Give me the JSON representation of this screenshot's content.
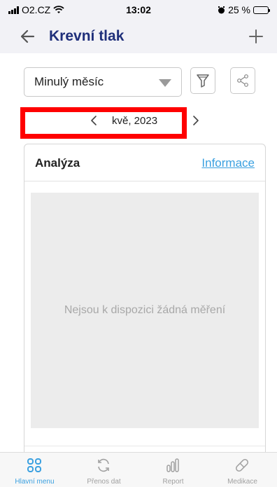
{
  "status_bar": {
    "carrier": "O2.CZ",
    "time": "13:02",
    "battery": "25 %",
    "icons": [
      "signal-icon",
      "wifi-icon",
      "alarm-icon",
      "battery-icon"
    ]
  },
  "nav": {
    "title": "Krevní tlak",
    "back_icon": "arrow-left-icon",
    "add_icon": "plus-icon"
  },
  "filter": {
    "period_value": "Minulý měsíc",
    "filter_icon": "funnel-icon",
    "share_icon": "share-icon"
  },
  "month_nav": {
    "label": "kvě, 2023",
    "highlight_color": "#ff0000"
  },
  "analysis": {
    "title": "Analýza",
    "info_link": "Informace",
    "empty_message": "Nejsou k dispozici žádná měření"
  },
  "tabs": [
    {
      "label": "Hlavní menu",
      "icon": "grid-icon",
      "active": true
    },
    {
      "label": "Přenos dat",
      "icon": "sync-icon",
      "active": false
    },
    {
      "label": "Report",
      "icon": "bar-chart-icon",
      "active": false
    },
    {
      "label": "Medikace",
      "icon": "pill-icon",
      "active": false
    }
  ],
  "colors": {
    "accent": "#3aa0e0",
    "title": "#1f2f7a",
    "header_bg": "#f2f2f6"
  }
}
